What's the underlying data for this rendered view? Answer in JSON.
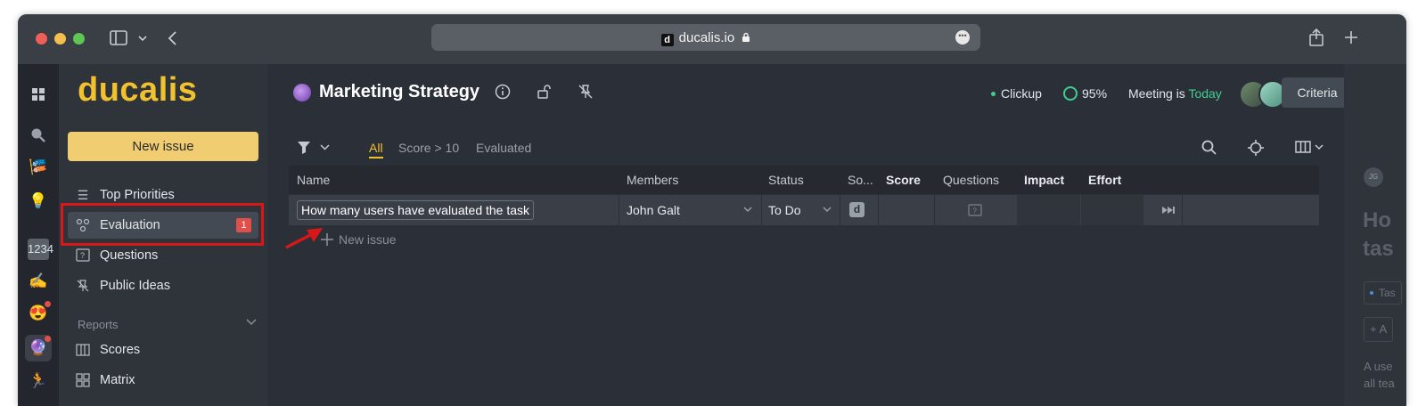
{
  "browser": {
    "url": "ducalis.io",
    "lock_icon": "lock-icon"
  },
  "rail": {
    "items": [
      "grid-icon",
      "search-icon",
      "flag-emoji",
      "bulb-emoji",
      "numbers-emoji",
      "writing-hand-emoji",
      "heart-eyes-emoji",
      "crystal-ball-emoji",
      "runner-emoji"
    ]
  },
  "sidebar": {
    "brand": "ducalis",
    "new_issue": "New issue",
    "items": [
      {
        "label": "Top Priorities",
        "icon": "list-icon"
      },
      {
        "label": "Evaluation",
        "icon": "nodes-icon",
        "badge": "1"
      },
      {
        "label": "Questions",
        "icon": "question-box-icon"
      },
      {
        "label": "Public Ideas",
        "icon": "no-pin-icon"
      }
    ],
    "reports_label": "Reports",
    "reports": [
      {
        "label": "Scores",
        "icon": "columns-icon"
      },
      {
        "label": "Matrix",
        "icon": "matrix-icon"
      }
    ]
  },
  "header": {
    "title": "Marketing Strategy",
    "integration": "Clickup",
    "progress": "95%",
    "meeting_label": "Meeting is",
    "meeting_value": "Today",
    "criteria": "Criteria"
  },
  "filters": {
    "tabs": [
      "All",
      "Score > 10",
      "Evaluated"
    ]
  },
  "table": {
    "columns": [
      "Name",
      "Members",
      "Status",
      "So...",
      "Score",
      "Questions",
      "Impact",
      "Effort"
    ],
    "rows": [
      {
        "name": "How many users have evaluated the task",
        "member": "John Galt",
        "status": "To Do",
        "source": "d"
      }
    ],
    "add_row": "New issue"
  },
  "right_panel": {
    "initials": "JG",
    "title_l1": "Ho",
    "title_l2": "tas",
    "tag": "Tas",
    "add": "A",
    "text_l1": "A use",
    "text_l2": "all tea"
  },
  "colors": {
    "brand": "#f2c12e",
    "accent_green": "#3ecf8e",
    "highlight": "#d81818"
  }
}
